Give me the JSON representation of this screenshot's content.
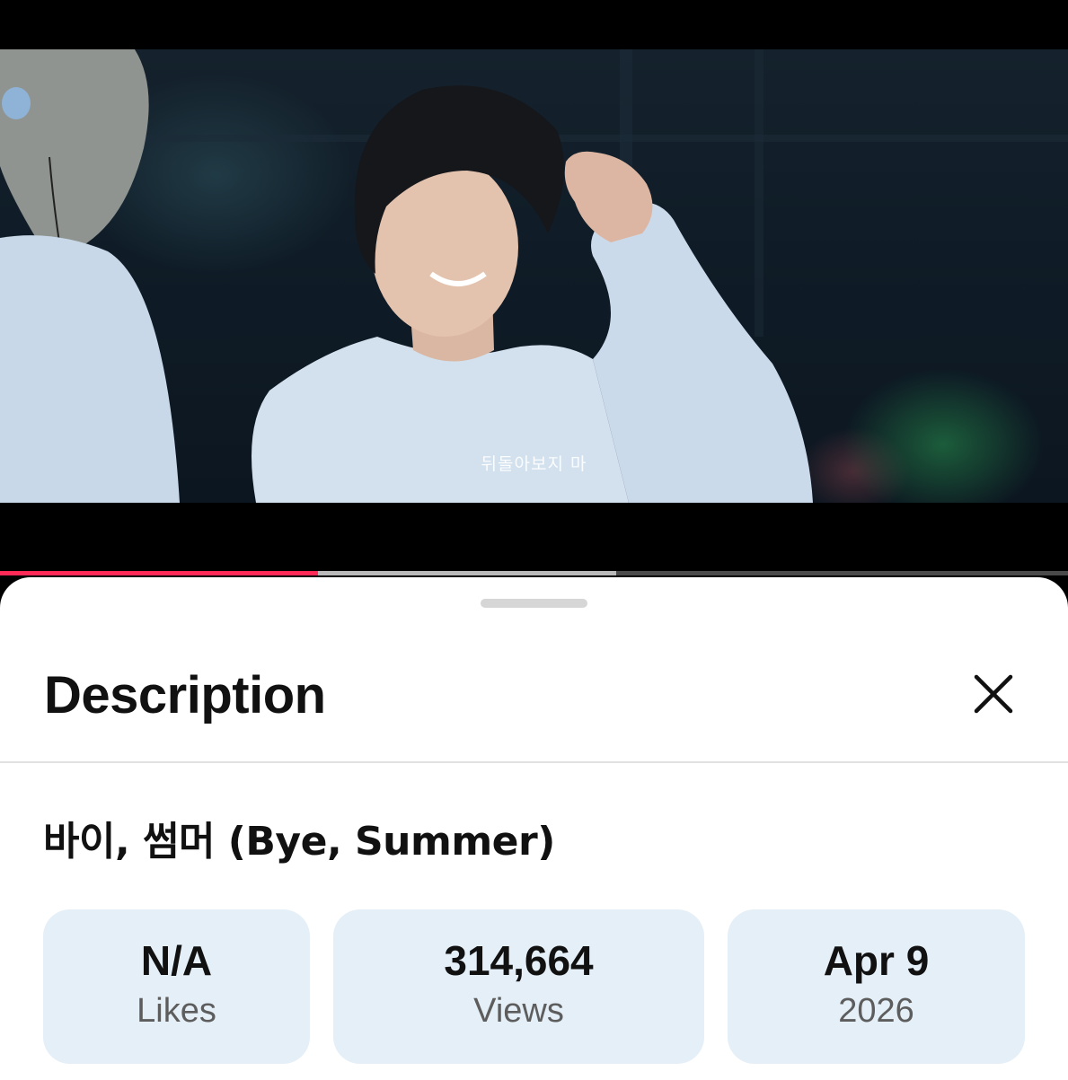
{
  "video": {
    "subtitle": "뒤돌아보지 마",
    "progress": {
      "played_fraction": 0.298,
      "buffered_fraction": 0.577
    }
  },
  "sheet": {
    "title": "Description",
    "close_icon": "close-icon",
    "video_title": "바이, 썸머 (Bye, Summer)",
    "stats": [
      {
        "value": "N/A",
        "label": "Likes"
      },
      {
        "value": "314,664",
        "label": "Views"
      },
      {
        "value": "Apr 9",
        "label": "2026"
      }
    ]
  },
  "colors": {
    "progress_played": "#ff2a55",
    "stat_card_bg": "#e4eff7",
    "sheet_bg": "#ffffff"
  }
}
